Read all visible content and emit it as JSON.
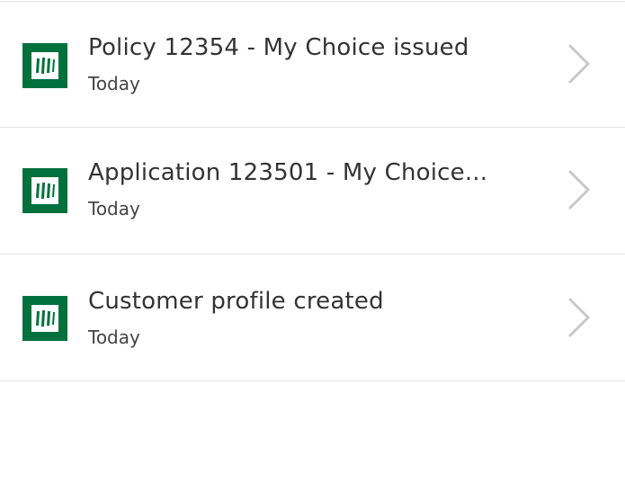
{
  "colors": {
    "brand_green": "#00703c",
    "divider": "#e3e3e3",
    "chevron": "#c8c8c8",
    "title_text": "#333333"
  },
  "activity_list": {
    "items": [
      {
        "icon": "manulife-logo-icon",
        "title": "Policy 12354 - My Choice issued",
        "date": "Today"
      },
      {
        "icon": "manulife-logo-icon",
        "title": "Application 123501 - My Choice...",
        "date": "Today"
      },
      {
        "icon": "manulife-logo-icon",
        "title": "Customer profile created",
        "date": "Today"
      }
    ]
  }
}
